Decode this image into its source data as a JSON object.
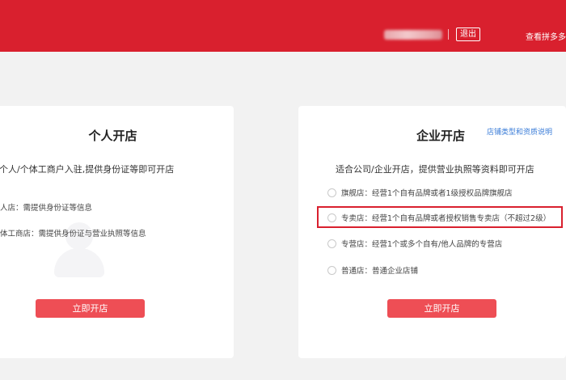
{
  "header": {
    "logout_label": "退出",
    "view_link": "查看拼多多",
    "brand_color": "#d9202e"
  },
  "personal": {
    "title": "个人开店",
    "description": "个人/个体工商户入驻,提供身份证等即可开店",
    "options": [
      "人店：需提供身份证等信息",
      "体工商店：需提供身份证与营业执照等信息"
    ],
    "button_label": "立即开店",
    "illustration_icon": "person-silhouette-icon"
  },
  "enterprise": {
    "title": "企业开店",
    "help_link": "店铺类型和资质说明",
    "description": "适合公司/企业开店，提供营业执照等资料即可开店",
    "options": [
      "旗舰店：经营1个自有品牌或者1级授权品牌旗舰店",
      "专卖店：经营1个自有品牌或者授权销售专卖店（不超过2级）",
      "专营店：经营1个或多个自有/他人品牌的专营店",
      "普通店：普通企业店铺"
    ],
    "highlighted_option_index": 1,
    "button_label": "立即开店",
    "button_color": "#ee4e55"
  }
}
